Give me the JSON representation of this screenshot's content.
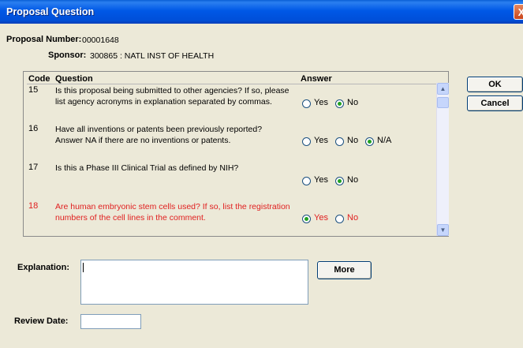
{
  "window": {
    "title": "Proposal Question",
    "close_glyph": "X"
  },
  "header": {
    "proposal_label": "Proposal Number:",
    "proposal_number": "00001648",
    "sponsor_label": "Sponsor:",
    "sponsor_value": "300865 : NATL INST OF HEALTH"
  },
  "grid": {
    "columns": {
      "code": "Code",
      "question": "Question",
      "answer": "Answer"
    },
    "rows": [
      {
        "code": "15",
        "q1": "Is this proposal being submitted to other agencies?  If so, please",
        "q2": "list agency acronyms in explanation separated by commas.",
        "yes": "Yes",
        "no": "No",
        "selected": "No",
        "highlight": false
      },
      {
        "code": "16",
        "q1": "Have all inventions or patents been previously reported?",
        "q2": "Answer NA if there are no inventions or patents.",
        "yes": "Yes",
        "no": "No",
        "na": "N/A",
        "selected": "N/A",
        "highlight": false
      },
      {
        "code": "17",
        "q1": "Is this a Phase III Clinical Trial as defined by NIH?",
        "q2": "",
        "yes": "Yes",
        "no": "No",
        "selected": "No",
        "highlight": false
      },
      {
        "code": "18",
        "q1": "Are human embryonic stem cells used?  If so, list the registration",
        "q2": "numbers of the cell lines in the comment.",
        "yes": "Yes",
        "no": "No",
        "selected": "Yes",
        "highlight": true
      }
    ]
  },
  "buttons": {
    "ok": "OK",
    "cancel": "Cancel",
    "more": "More"
  },
  "form": {
    "explanation_label": "Explanation:",
    "explanation_value": "",
    "review_date_label": "Review Date:",
    "review_date_value": ""
  },
  "colors": {
    "title_bar": "#0058e6",
    "highlight_text": "#e02020",
    "dialog_bg": "#ece9d8"
  }
}
